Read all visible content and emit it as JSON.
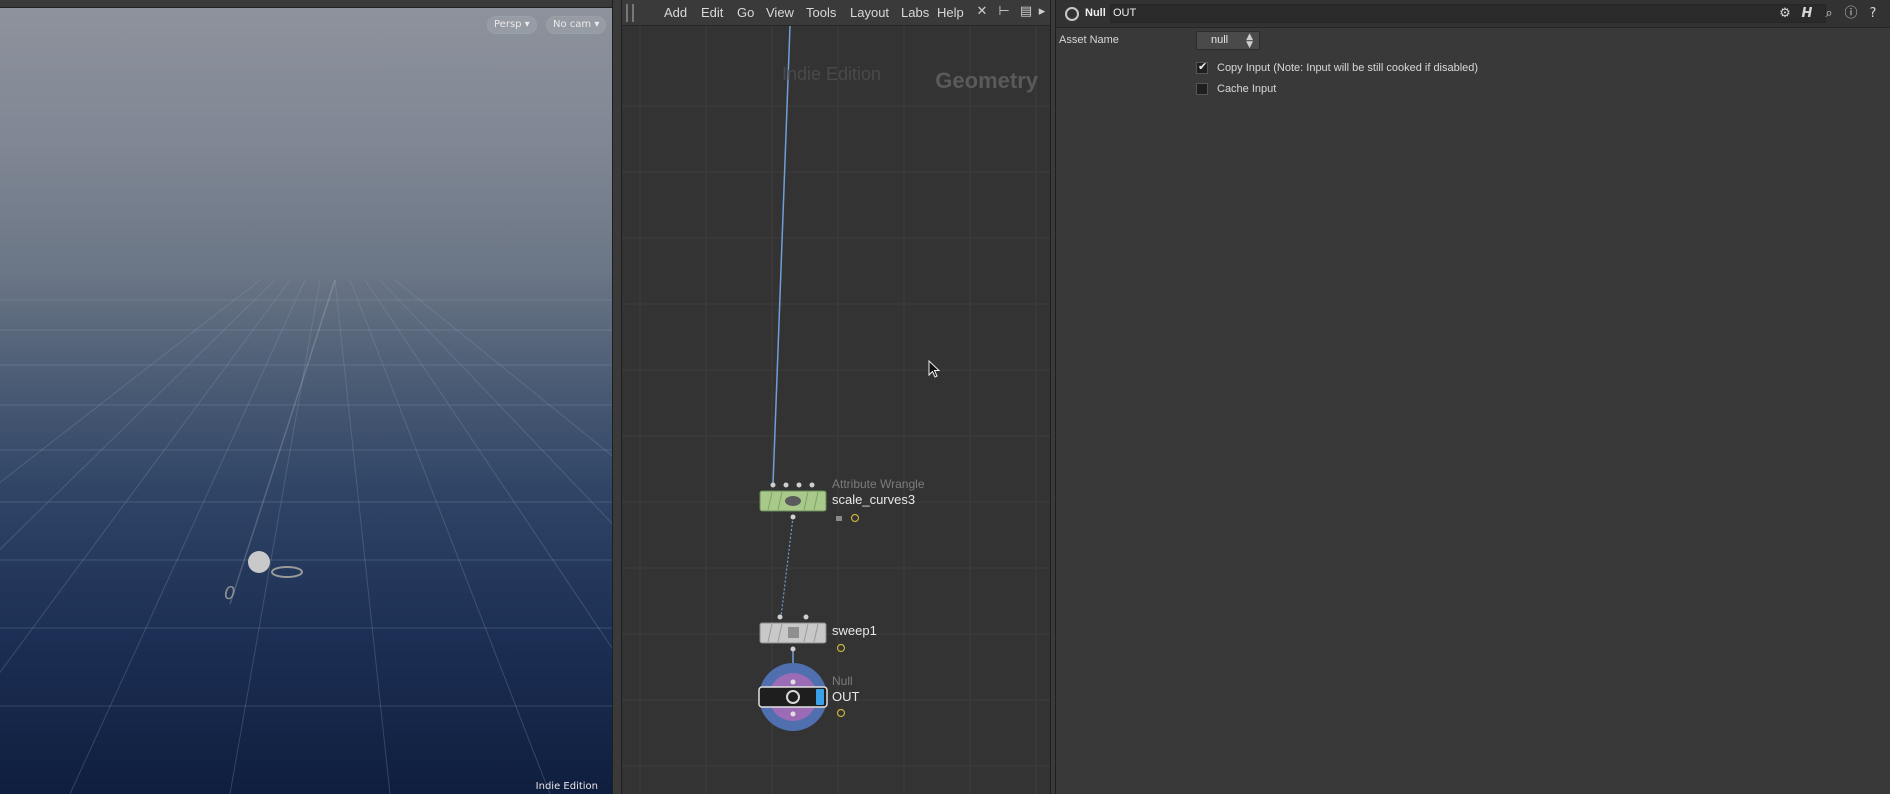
{
  "viewport": {
    "persp_label": "Persp ▾",
    "cam_label": "No cam ▾",
    "edition_label": "Indie Edition",
    "axis_label": "0"
  },
  "network": {
    "menu": [
      "Add",
      "Edit",
      "Go",
      "View",
      "Tools",
      "Layout",
      "Labs",
      "Help"
    ],
    "watermark_edition": "Indie Edition",
    "context_label": "Geometry",
    "nodes": {
      "wrangle": {
        "type": "Attribute Wrangle",
        "name": "scale_curves3"
      },
      "sweep": {
        "type": "",
        "name": "sweep1"
      },
      "null": {
        "type": "Null",
        "name": "OUT"
      }
    }
  },
  "params": {
    "node_type": "Null",
    "node_name": "OUT",
    "asset_name_label": "Asset Name",
    "asset_name_value": "null",
    "copy_input_label": "Copy Input (Note: Input will be still cooked if disabled)",
    "copy_input_checked": true,
    "cache_input_label": "Cache Input",
    "cache_input_checked": false
  },
  "colors": {
    "wrangle_node": "#a8c98a",
    "sweep_node": "#c8c8c8",
    "null_ring": "#4f6fae",
    "null_inner": "#9b6bb5",
    "wire": "#6f9fd8"
  }
}
